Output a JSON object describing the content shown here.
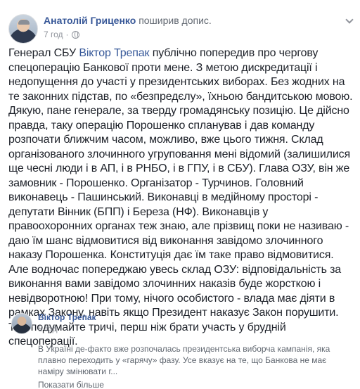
{
  "header": {
    "author": "Анатолій Гриценко",
    "action": "поширив допис.",
    "timestamp": "7 год"
  },
  "post": {
    "text_before_mention": "Генерал СБУ ",
    "mention": "Віктор Трепак",
    "text_after_mention": " публічно попередив про чергову спецоперацію Банкової проти мене. З метою дискредитації і недопущення до участі у президентських виборах. Без жодних на те законних підстав, по «безпредєлу», їхньою бандитською мовою. Дякую, пане генерале, за тверду громадянську позицію. Це дійсно правда, таку операцію Порошенко спланував і дав команду розпочати ближчим часом, можливо, вже цього тижня. Склад організованого злочинного угруповання мені відомий (залишилися ще чесні люди і в АП, і в РНБО, і в ГПУ, і в СБУ). Глава ОЗУ, він же замовник - Порошенко. Організатор - Турчинов. Головний виконавець - Пашинський. Виконавці в медійному просторі - депутати Вінник (БПП) і Береза (НФ). Виконавців у правоохоронних органах теж знаю, але прізвищ поки не називаю - даю їм шанс відмовитися від виконання завідомо злочинного наказу Порошенка. Конституція дає їм таке право відмовитися. Але водночас попереджаю увесь склад ОЗУ: відповідальність за виконання вами завідомо злочинних наказів буде жорсткою і невідворотною! При тому, нічого особистого - влада має діяти в рамках Закону, навіть якщо Президент наказує Закон порушити. Тож подумайте тричі, перш ніж брати участь у брудній спецоперації."
  },
  "shared_post": {
    "author": "Віктор Трепак",
    "timestamp": "8 год",
    "text": "В Україні де-факто вже розпочалась президентська виборча кампанія, яка плавно переходить у «гарячу» фазу. Усе вказує на те, що Банкова не має наміру змінювати г...",
    "see_more": "Показати більше"
  },
  "icons": {
    "visibility": "globe-icon",
    "options": "chevron-down-icon"
  },
  "colors": {
    "link": "#385898",
    "text": "#1d2129",
    "muted": "#90949c"
  }
}
